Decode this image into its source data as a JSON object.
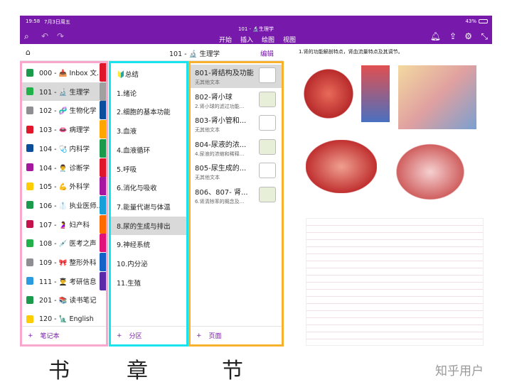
{
  "status": {
    "time": "19:58",
    "date": "7月3日周五",
    "battery": "43%"
  },
  "header": {
    "title": "101 - 🔬生理学",
    "menus": [
      "开始",
      "插入",
      "绘图",
      "视图"
    ]
  },
  "subheader": {
    "notebook_title": "101 - 🔬 生理学",
    "edit": "编辑"
  },
  "notebooks": {
    "items": [
      "000 - 📥 Inbox 文...",
      "101 - 🔬 生理学",
      "102 - 🧬 生物化学",
      "103 - 👄 病理学",
      "104 - 🩺 内科学",
      "104 - 👨‍⚕️ 诊断学",
      "105 - 💪 外科学",
      "106 - 🥼 执业医师...",
      "107 - 🤰 妇产科",
      "108 - 💉 医考之声",
      "109 - 🎀 整形外科",
      "111 - 👨‍🎓 考研信息",
      "201 - 📚 读书笔记",
      "120 - 🗽 English"
    ],
    "colors": [
      "#1a9a4a",
      "#22b04a",
      "#8e8e93",
      "#e0162b",
      "#0b4f9c",
      "#a5179f",
      "#ffcc00",
      "#1a9a4a",
      "#c5124d",
      "#22b04a",
      "#8e8e93",
      "#2b9be0",
      "#1a9a4a",
      "#ffcc00"
    ],
    "add": "笔记本"
  },
  "tabs": {
    "colors": [
      "#e0162b",
      "#a0a0a0",
      "#0b4f9c",
      "#ffa500",
      "#1a9a4a",
      "#e0162b",
      "#a5179f",
      "#19a0d8",
      "#ff6a00",
      "#e0127a",
      "#1462c8",
      "#5b2aa8"
    ]
  },
  "sections": {
    "items": [
      "🔰总结",
      "1.绪论",
      "2.细胞的基本功能",
      "3.血液",
      "4.血液循环",
      "5.呼吸",
      "6.消化与吸收",
      "7.能量代谢与体温",
      "8.尿的生成与排出",
      "9.神经系统",
      "10.内分泌",
      "11.生殖"
    ],
    "add": "分区"
  },
  "pages": {
    "items": [
      {
        "title": "801-肾结构及功能",
        "sub": "无其他文本"
      },
      {
        "title": "802-肾小球",
        "sub": "2.肾小球的滤过功能..."
      },
      {
        "title": "803-肾小管和...",
        "sub": "无其他文本"
      },
      {
        "title": "804-尿液的浓...",
        "sub": "4.尿液的浓缩和稀释..."
      },
      {
        "title": "805-尿生成的...",
        "sub": "无其他文本"
      },
      {
        "title": "806、807- 肾...",
        "sub": "6.肾清除率的概念及..."
      }
    ],
    "add": "页面"
  },
  "content": {
    "heading": "1.肾的功能解剖特点，肾血流量特点及其调节。"
  },
  "labels": {
    "book": "书",
    "chapter": "章",
    "section": "节",
    "watermark": "知乎用户"
  }
}
